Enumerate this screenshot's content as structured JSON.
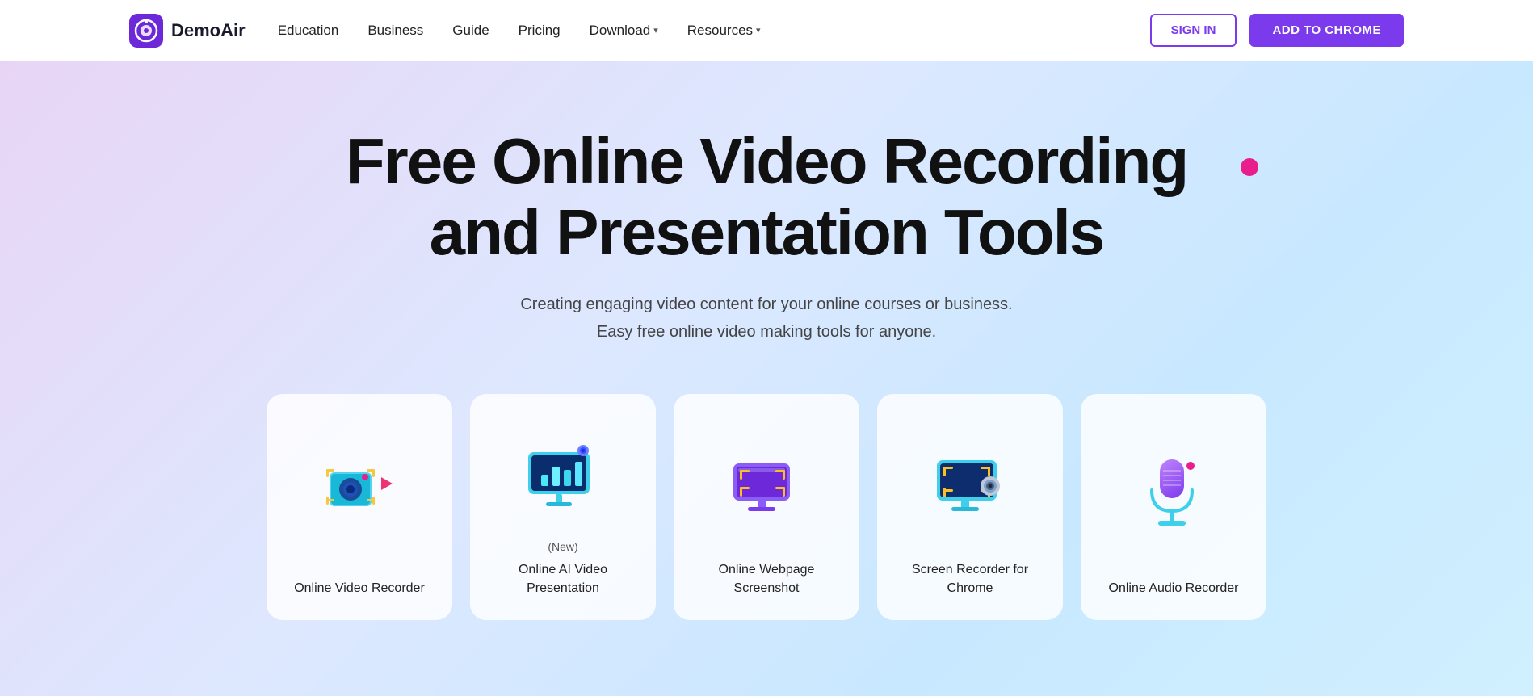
{
  "brand": {
    "name": "DemoAir",
    "logo_alt": "DemoAir logo"
  },
  "navbar": {
    "links": [
      {
        "label": "Education",
        "has_dropdown": false
      },
      {
        "label": "Business",
        "has_dropdown": false
      },
      {
        "label": "Guide",
        "has_dropdown": false
      },
      {
        "label": "Pricing",
        "has_dropdown": false
      },
      {
        "label": "Download",
        "has_dropdown": true
      },
      {
        "label": "Resources",
        "has_dropdown": true
      }
    ],
    "sign_in_label": "SIGN IN",
    "add_to_chrome_label": "ADD TO CHROME"
  },
  "hero": {
    "title_line1": "Free Online Video Recording",
    "title_line2": "and Presentation Tools",
    "subtitle_line1": "Creating engaging video content for your online courses or business.",
    "subtitle_line2": "Easy free online video making tools for anyone."
  },
  "cards": [
    {
      "id": "video-recorder",
      "label": "Online Video Recorder",
      "new_badge": "",
      "icon": "video-recorder-icon"
    },
    {
      "id": "ai-presentation",
      "label": "Online AI Video Presentation",
      "new_badge": "(New)",
      "icon": "ai-presentation-icon"
    },
    {
      "id": "webpage-screenshot",
      "label": "Online Webpage Screenshot",
      "new_badge": "",
      "icon": "screenshot-icon"
    },
    {
      "id": "screen-recorder",
      "label": "Screen Recorder for Chrome",
      "new_badge": "",
      "icon": "screen-recorder-icon"
    },
    {
      "id": "audio-recorder",
      "label": "Online Audio Recorder",
      "new_badge": "",
      "icon": "audio-recorder-icon"
    }
  ],
  "accent_colors": {
    "purple": "#7c3aed",
    "pink": "#e91e8c",
    "blue": "#3b82f6"
  }
}
